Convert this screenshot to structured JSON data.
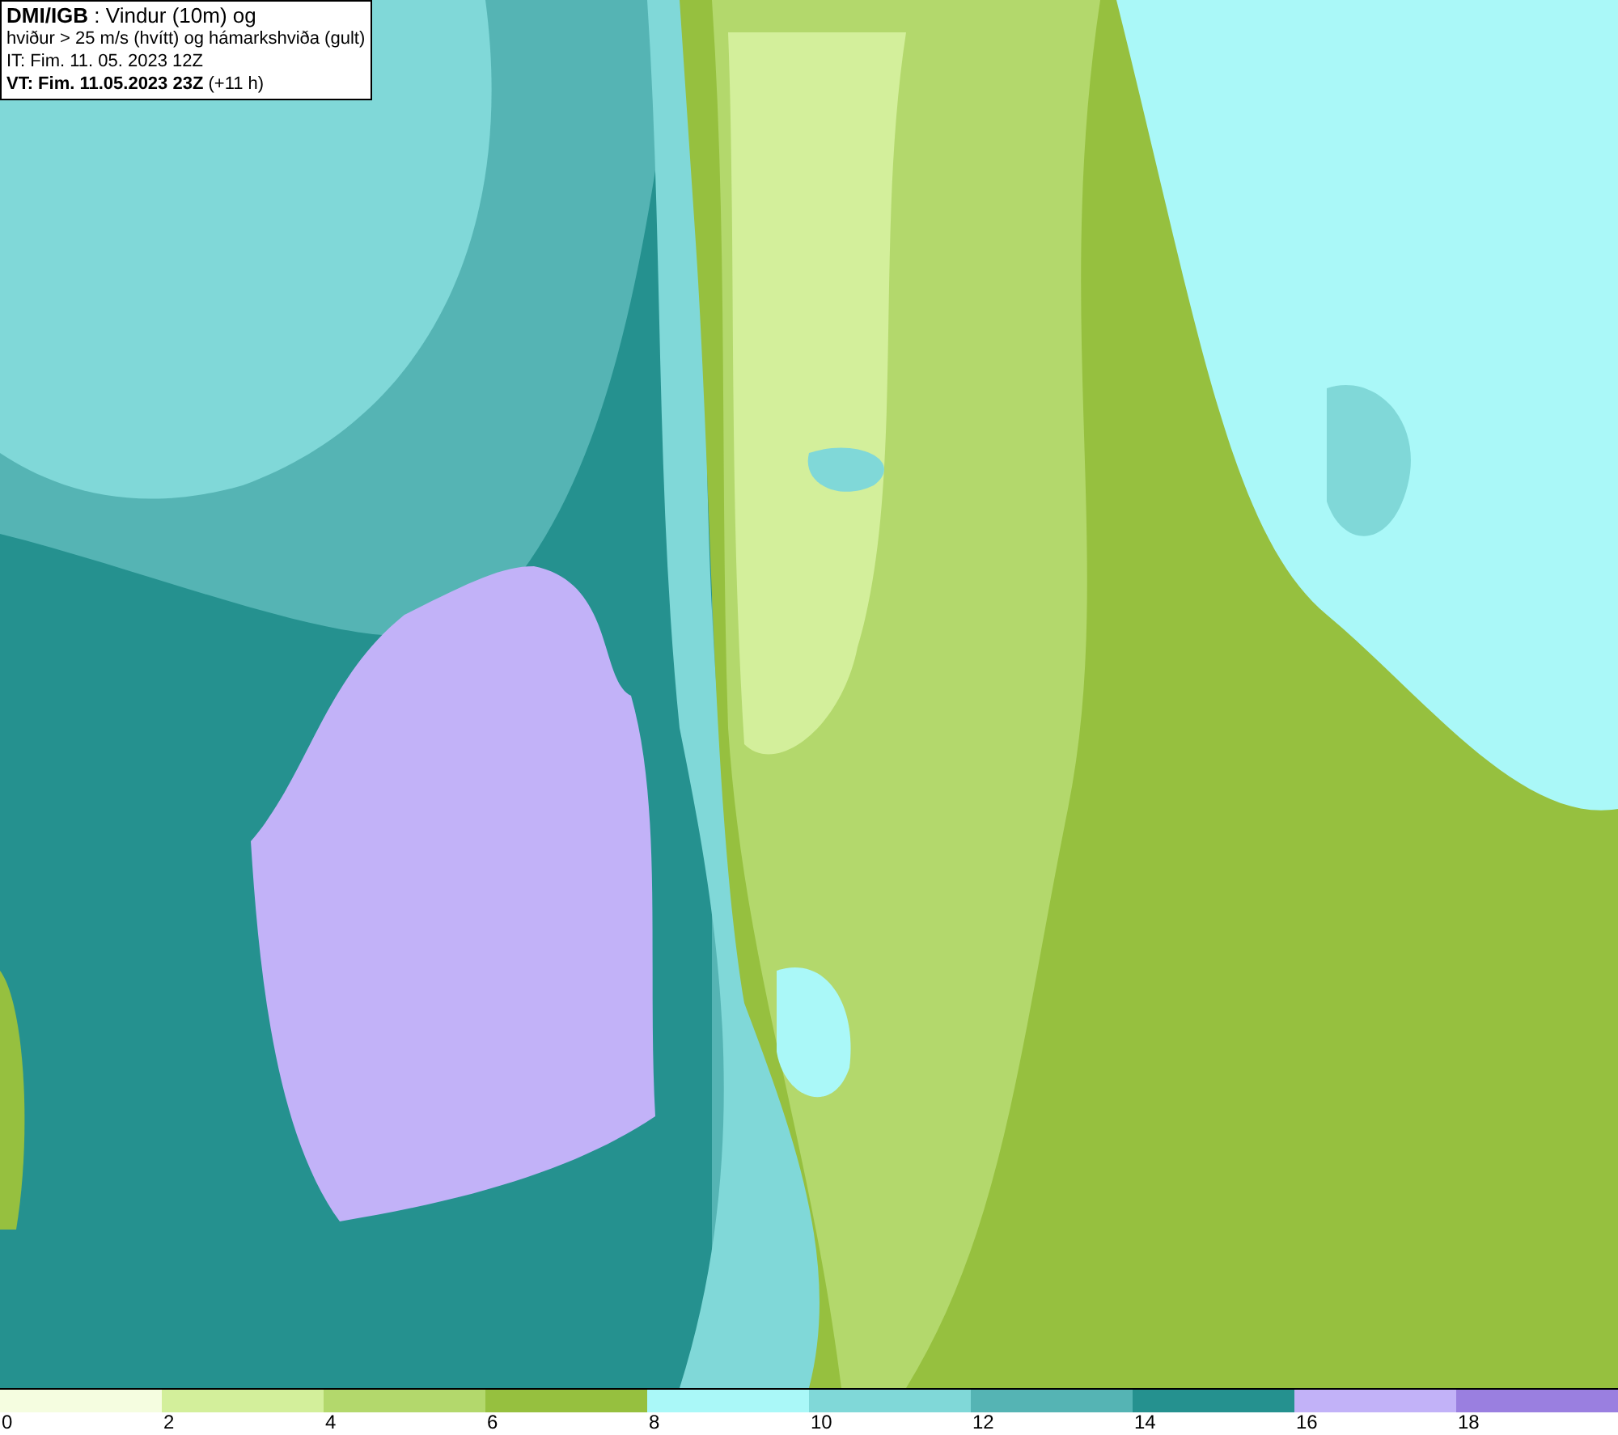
{
  "info_box": {
    "lines": [
      "**DMI/IGB** : Vindur (10m) og",
      "hviður > 25 m/s (hvítt) og hámarkshviða (gult)",
      "IT: Fim. 11. 05. 2023 12Z",
      "**VT: Fim. 11.05.2023 23Z** (+11 h)"
    ]
  },
  "legend": {
    "segments": [
      {
        "label": "0",
        "color": "#f5fde0"
      },
      {
        "label": "2",
        "color": "#d3ef9b"
      },
      {
        "label": "4",
        "color": "#b3d86c"
      },
      {
        "label": "6",
        "color": "#96c03f"
      },
      {
        "label": "8",
        "color": "#aaf8f8"
      },
      {
        "label": "10",
        "color": "#80d8d8"
      },
      {
        "label": "12",
        "color": "#55b4b4"
      },
      {
        "label": "14",
        "color": "#25918f"
      },
      {
        "label": "16",
        "color": "#c2b2f8"
      },
      {
        "label": "18",
        "color": "#9a7fe0"
      }
    ]
  }
}
